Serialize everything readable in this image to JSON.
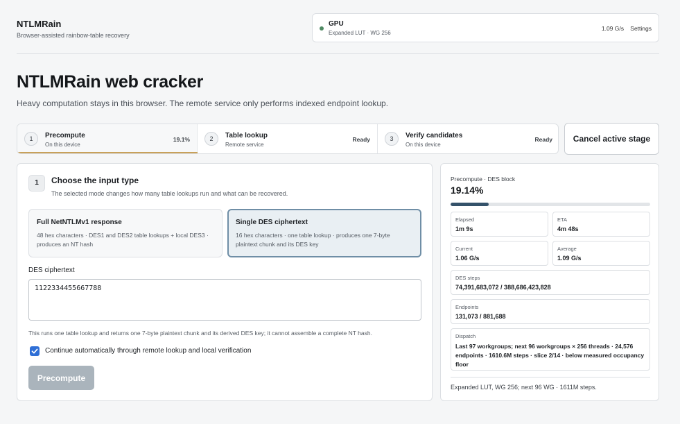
{
  "app": {
    "title": "NTLMRain",
    "subtitle": "Browser-assisted rainbow-table recovery"
  },
  "gpu": {
    "name": "GPU",
    "detail": "Expanded LUT · WG 256",
    "rate": "1.09 G/s",
    "settings_label": "Settings",
    "status_color": "#4f8a63"
  },
  "page": {
    "title": "NTLMRain web cracker",
    "subtitle": "Heavy computation stays in this browser. The remote service only performs indexed endpoint lookup."
  },
  "stages": [
    {
      "num": "1",
      "name": "Precompute",
      "sub": "On this device",
      "status": "19.1%",
      "active": true
    },
    {
      "num": "2",
      "name": "Table lookup",
      "sub": "Remote service",
      "status": "Ready"
    },
    {
      "num": "3",
      "name": "Verify candidates",
      "sub": "On this device",
      "status": "Ready"
    }
  ],
  "cancel_label": "Cancel active stage",
  "input_panel": {
    "num": "1",
    "title": "Choose the input type",
    "subtitle": "The selected mode changes how many table lookups run and what can be recovered.",
    "modes": [
      {
        "title": "Full NetNTLMv1 response",
        "desc": "48 hex characters · DES1 and DES2 table lookups + local DES3 · produces an NT hash",
        "selected": false
      },
      {
        "title": "Single DES ciphertext",
        "desc": "16 hex characters · one table lookup · produces one 7-byte plaintext chunk and its DES key",
        "selected": true
      }
    ],
    "field_label": "DES ciphertext",
    "field_value": "1122334455667788",
    "hint": "This runs one table lookup and returns one 7-byte plaintext chunk and its derived DES key; it cannot assemble a complete NT hash.",
    "auto_continue_label": "Continue automatically through remote lookup and local verification",
    "auto_continue_checked": true,
    "precompute_label": "Precompute"
  },
  "progress": {
    "label": "Precompute · DES block",
    "percent_text": "19.14%",
    "fraction": 0.1914,
    "elapsed_label": "Elapsed",
    "elapsed": "1m 9s",
    "eta_label": "ETA",
    "eta": "4m 48s",
    "current_label": "Current",
    "current": "1.06 G/s",
    "average_label": "Average",
    "average": "1.09 G/s",
    "des_steps_label": "DES steps",
    "des_steps": "74,391,683,072 / 388,686,423,828",
    "endpoints_label": "Endpoints",
    "endpoints": "131,073 / 881,688",
    "dispatch_label": "Dispatch",
    "dispatch": "Last 97 workgroups; next 96 workgroups × 256 threads · 24,576 endpoints · 1610.6M steps · slice 2/14 · below measured occupancy floor",
    "footer": "Expanded LUT, WG 256; next 96 WG · 1611M steps."
  },
  "colors": {
    "accent_bar": "#c8a15a",
    "progress_fill": "#34526a",
    "selected_border": "#6f8ea6",
    "checkbox": "#2f6fd6"
  }
}
